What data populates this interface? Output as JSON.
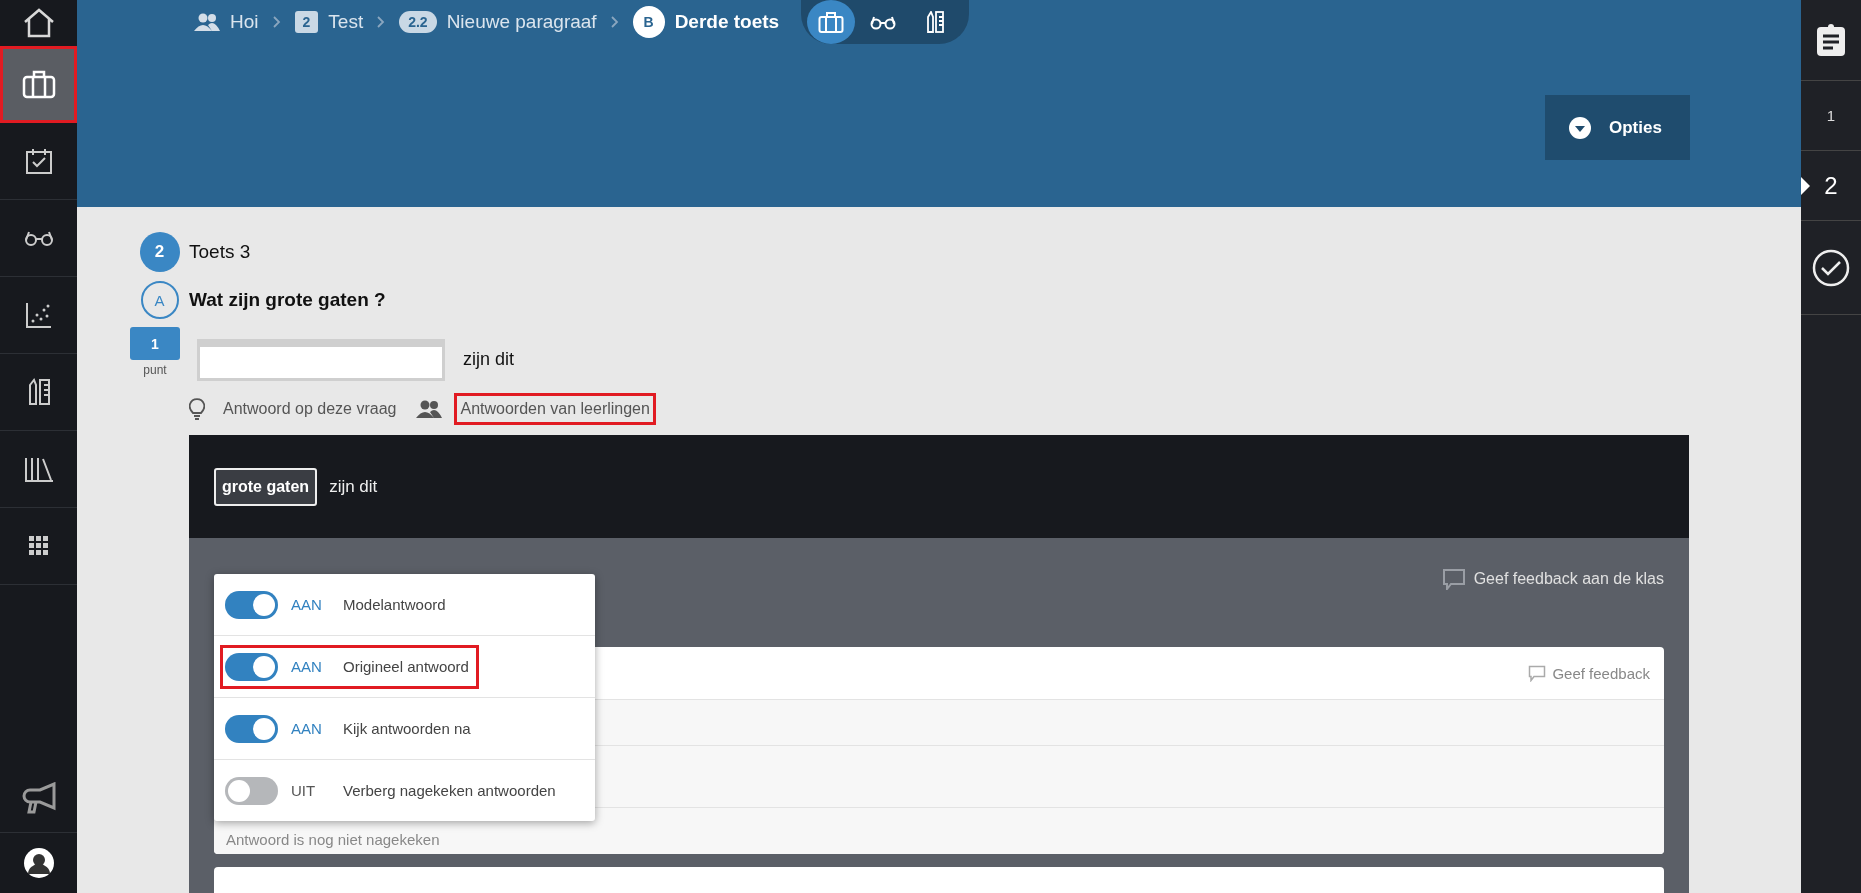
{
  "sidebar": {
    "items": [
      {
        "selected": false,
        "highlighted": false
      },
      {
        "selected": true,
        "highlighted": true
      },
      {
        "selected": false,
        "highlighted": false
      },
      {
        "selected": false,
        "highlighted": false
      },
      {
        "selected": false,
        "highlighted": false
      },
      {
        "selected": false,
        "highlighted": false
      },
      {
        "selected": false,
        "highlighted": false
      },
      {
        "selected": false,
        "highlighted": false
      }
    ]
  },
  "breadcrumb": [
    {
      "kind": "group",
      "label": "Hoi"
    },
    {
      "kind": "chapter",
      "badge": "2",
      "label": "Test"
    },
    {
      "kind": "paragraph",
      "badge": "2.2",
      "label": "Nieuwe paragraaf"
    },
    {
      "kind": "test",
      "badge": "B",
      "label": "Derde toets"
    }
  ],
  "mode_switch": [
    {
      "selected": true
    },
    {
      "selected": false
    },
    {
      "selected": false
    }
  ],
  "options_button": {
    "label": "Opties"
  },
  "right_nav": [
    {
      "kind": "overview",
      "selected": false
    },
    {
      "kind": "number",
      "label": "1",
      "selected": false
    },
    {
      "kind": "number",
      "label": "2",
      "selected": true
    },
    {
      "kind": "finish",
      "selected": false
    }
  ],
  "section": {
    "number": "2",
    "title": "Toets 3"
  },
  "question": {
    "letter": "A",
    "title": "Wat zijn grote gaten ?",
    "points": "1",
    "points_unit": "punt",
    "after_field": "zijn dit"
  },
  "links": [
    {
      "kind": "answer",
      "label": "Antwoord op deze vraag",
      "highlighted": false
    },
    {
      "kind": "students",
      "label": "Antwoorden van leerlingen",
      "highlighted": true
    }
  ],
  "model_answer": {
    "chip": "grote gaten",
    "rest": "zijn dit"
  },
  "class_feedback": "Geef feedback aan de klas",
  "answer_cards": [
    {
      "feedback": "Geef feedback",
      "status": "Antwoord is nog niet nagekeken"
    }
  ],
  "options_menu": [
    {
      "on": true,
      "state": "AAN",
      "label": "Modelantwoord",
      "highlighted": false
    },
    {
      "on": true,
      "state": "AAN",
      "label": "Origineel antwoord",
      "highlighted": true
    },
    {
      "on": true,
      "state": "AAN",
      "label": "Kijk antwoorden na",
      "highlighted": false
    },
    {
      "on": false,
      "state": "UIT",
      "label": "Verberg nagekeken antwoorden",
      "highlighted": false
    }
  ]
}
